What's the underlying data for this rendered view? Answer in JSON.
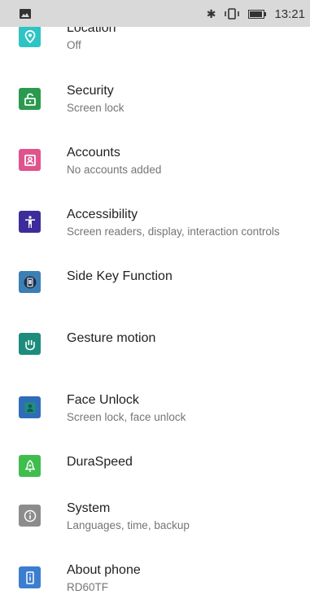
{
  "status_bar": {
    "time": "13:21"
  },
  "settings": [
    {
      "title": "Location",
      "subtitle": "Off",
      "icon": "location-icon",
      "color": "#2ec4c4"
    },
    {
      "title": "Security",
      "subtitle": "Screen lock",
      "icon": "lock-icon",
      "color": "#2b9a4f"
    },
    {
      "title": "Accounts",
      "subtitle": "No accounts added",
      "icon": "account-icon",
      "color": "#e0538d"
    },
    {
      "title": "Accessibility",
      "subtitle": "Screen readers, display, interaction controls",
      "icon": "accessibility-icon",
      "color": "#3c2d9b"
    },
    {
      "title": "Side Key Function",
      "subtitle": "",
      "icon": "side-key-icon",
      "color": "#3b7fb5"
    },
    {
      "title": "Gesture motion",
      "subtitle": "",
      "icon": "gesture-icon",
      "color": "#1d8c7c"
    },
    {
      "title": "Face Unlock",
      "subtitle": "Screen lock, face unlock",
      "icon": "face-unlock-icon",
      "color": "#2f6db8"
    },
    {
      "title": "DuraSpeed",
      "subtitle": "",
      "icon": "duraspeed-icon",
      "color": "#3fbe4e"
    },
    {
      "title": "System",
      "subtitle": "Languages, time, backup",
      "icon": "info-icon",
      "color": "#8c8c8c"
    },
    {
      "title": "About phone",
      "subtitle": "RD60TF",
      "icon": "phone-icon",
      "color": "#3b7ed0"
    }
  ]
}
